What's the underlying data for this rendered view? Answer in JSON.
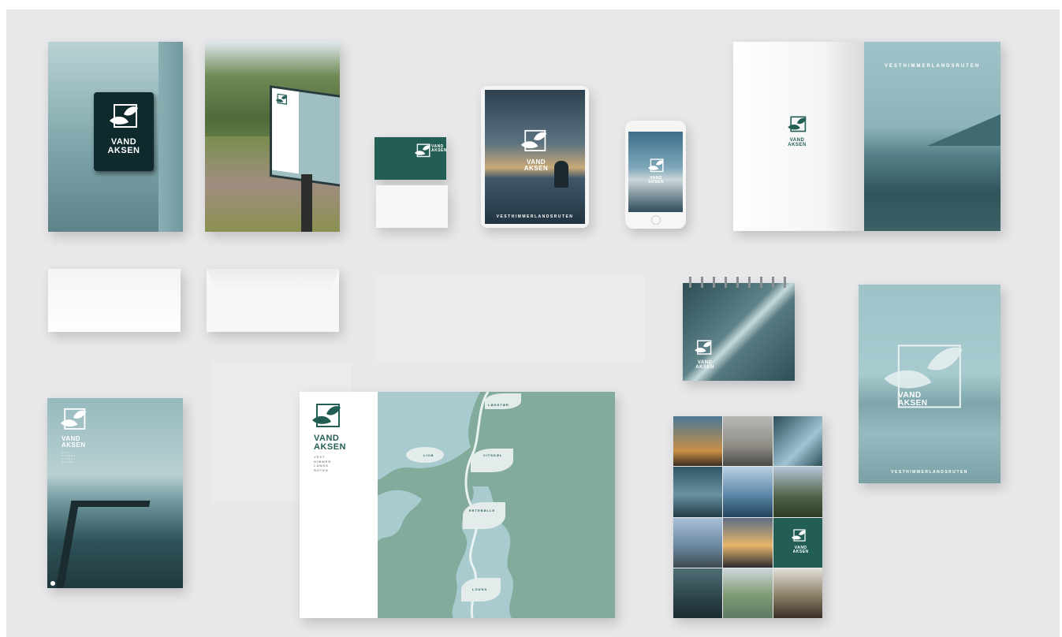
{
  "brand": {
    "name_line1": "VAND",
    "name_line2": "AKSEN",
    "route_name": "VESTHIMMERLANDSRUTEN",
    "route_stack": [
      "VEST",
      "HIMMER",
      "LANDS",
      "RUTEN"
    ]
  },
  "colors": {
    "board": "#e8e8ea",
    "brand_green": "#235e55",
    "teal_light": "#a6c8cc",
    "teal_mid": "#7fa9a8",
    "map_green": "#82ab9c",
    "map_water": "#a9cbd0"
  },
  "map": {
    "stops": [
      "LØGSTØR",
      "LIVØ",
      "VITSKØL",
      "ERTEBØLLE",
      "LOUNS"
    ]
  },
  "icons": {
    "logo": "leaf-square-logo-icon"
  }
}
